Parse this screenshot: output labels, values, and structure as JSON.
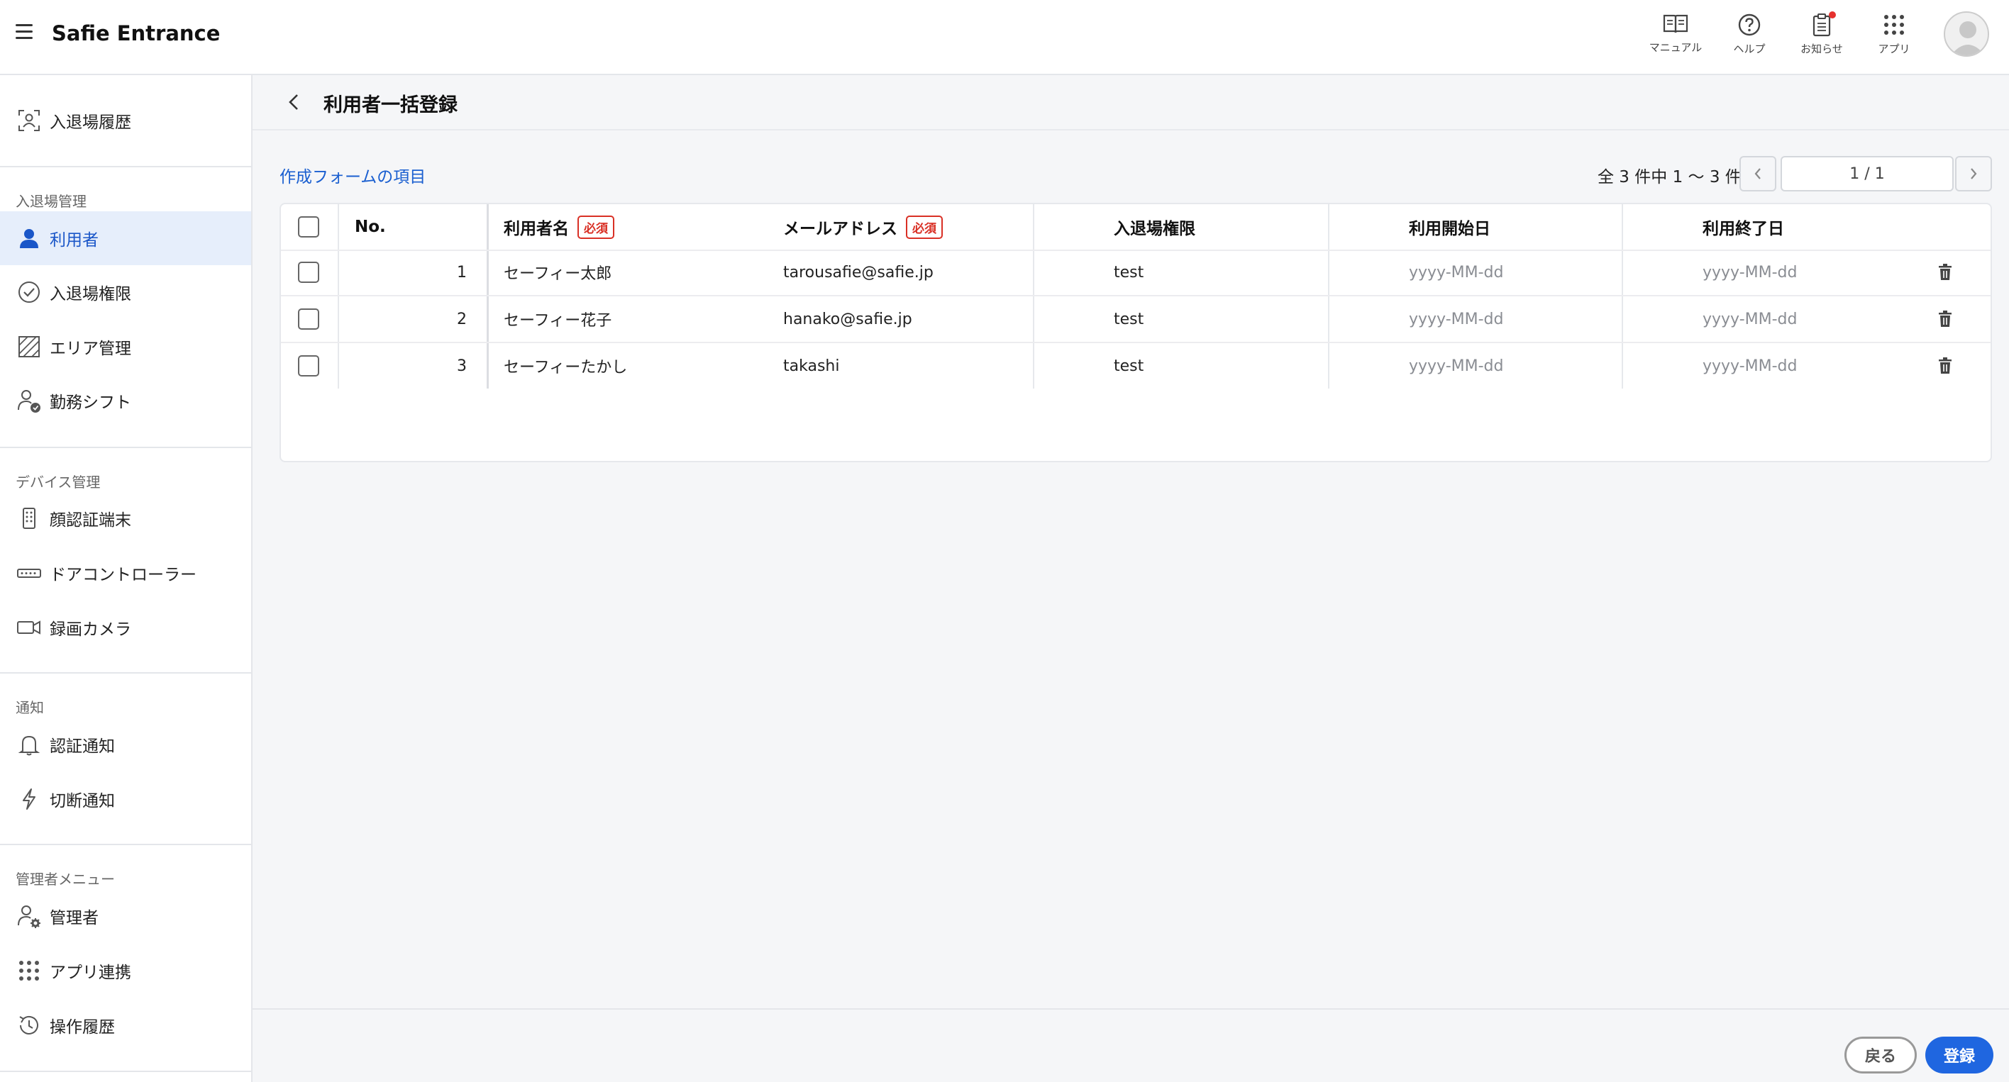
{
  "app": {
    "title": "Safie Entrance"
  },
  "header": {
    "tools": [
      {
        "icon": "manual-book-icon",
        "label": "マニュアル"
      },
      {
        "icon": "help-circle-icon",
        "label": "ヘルプ"
      },
      {
        "icon": "notification-clipboard-icon",
        "label": "お知らせ"
      },
      {
        "icon": "apps-grid-icon",
        "label": "アプリ"
      }
    ]
  },
  "sidebar": {
    "top_item": {
      "label": "入退場履歴",
      "icon": "entry-history-icon"
    },
    "sections": [
      {
        "title": "入退場管理",
        "items": [
          {
            "label": "利用者",
            "icon": "user-icon",
            "active": true
          },
          {
            "label": "入退場権限",
            "icon": "check-circle-icon"
          },
          {
            "label": "エリア管理",
            "icon": "area-icon"
          },
          {
            "label": "勤務シフト",
            "icon": "shift-user-icon"
          }
        ]
      },
      {
        "title": "デバイス管理",
        "items": [
          {
            "label": "顔認証端末",
            "icon": "face-device-icon"
          },
          {
            "label": "ドアコントローラー",
            "icon": "door-controller-icon"
          },
          {
            "label": "録画カメラ",
            "icon": "camera-icon"
          }
        ]
      },
      {
        "title": "通知",
        "items": [
          {
            "label": "認証通知",
            "icon": "bell-icon"
          },
          {
            "label": "切断通知",
            "icon": "lightning-icon"
          }
        ]
      },
      {
        "title": "管理者メニュー",
        "items": [
          {
            "label": "管理者",
            "icon": "admin-gear-icon"
          },
          {
            "label": "アプリ連携",
            "icon": "apps-grid-icon"
          },
          {
            "label": "操作履歴",
            "icon": "history-clock-icon"
          }
        ]
      }
    ]
  },
  "page": {
    "title": "利用者一括登録",
    "form_link": "作成フォームの項目",
    "pagination": {
      "summary": "全 3 件中 1 〜 3 件",
      "page": "1 / 1"
    }
  },
  "table": {
    "headers": {
      "no": "No.",
      "name": "利用者名",
      "email": "メールアドレス",
      "permission": "入退場権限",
      "start": "利用開始日",
      "end": "利用終了日",
      "required_badge": "必須"
    },
    "rows": [
      {
        "no": "1",
        "name": "セーフィー太郎",
        "email": "tarousafie@safie.jp",
        "permission": "test",
        "start": "yyyy-MM-dd",
        "end": "yyyy-MM-dd"
      },
      {
        "no": "2",
        "name": "セーフィー花子",
        "email": "hanako@safie.jp",
        "permission": "test",
        "start": "yyyy-MM-dd",
        "end": "yyyy-MM-dd"
      },
      {
        "no": "3",
        "name": "セーフィーたかし",
        "email": "takashi",
        "permission": "test",
        "start": "yyyy-MM-dd",
        "end": "yyyy-MM-dd"
      }
    ]
  },
  "footer": {
    "back_label": "戻る",
    "register_label": "登録"
  }
}
